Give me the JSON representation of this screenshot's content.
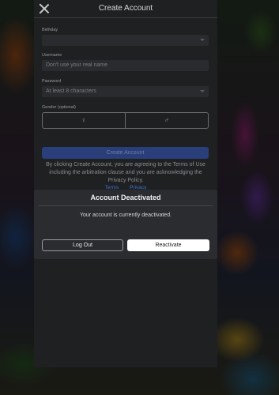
{
  "header": {
    "title": "Create Account"
  },
  "form": {
    "birthday_label": "Birthday",
    "username_label": "Username",
    "username_placeholder": "Don't use your real name",
    "password_label": "Password",
    "password_placeholder": "At least 8 characters",
    "gender_label": "Gender (optional)",
    "gender_female_icon": "♀",
    "gender_male_icon": "♂",
    "create_button": "Create Account",
    "terms_text": "By clicking Create Account, you are agreeing to the Terms of Use including the arbitration clause and you are acknowledging the Privacy Policy.",
    "terms_link": "Terms",
    "privacy_link": "Privacy"
  },
  "modal": {
    "title": "Account Deactivated",
    "message": "Your account is currently deactivated.",
    "logout_button": "Log Out",
    "reactivate_button": "Reactivate"
  },
  "icons": {
    "close": "close-icon",
    "dropdown": "chevron-down-icon",
    "gender_female": "female-icon",
    "gender_male": "male-icon"
  },
  "colors": {
    "create_button": "#2a3e7a",
    "link": "#3f6fd0",
    "modal_bg": "#2b2c2f",
    "reactivate_bg": "#ffffff"
  }
}
